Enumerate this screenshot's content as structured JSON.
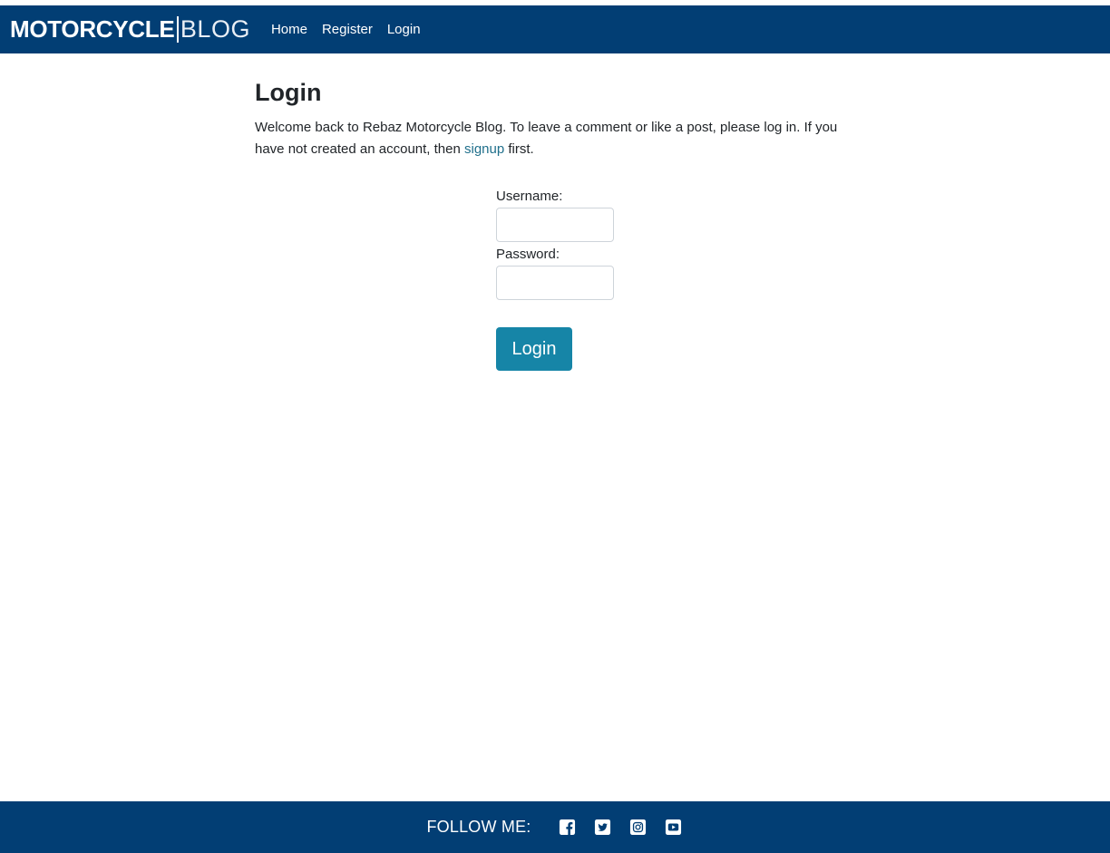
{
  "navbar": {
    "brand_bold": "MOTORCYCLE",
    "brand_light": "BLOG",
    "links": [
      {
        "label": "Home"
      },
      {
        "label": "Register"
      },
      {
        "label": "Login"
      }
    ]
  },
  "main": {
    "title": "Login",
    "intro_before_link": "Welcome back to Rebaz Motorcycle Blog. To leave a comment or like a post, please log in. If you have not created an account, then ",
    "intro_link": "signup",
    "intro_after_link": " first."
  },
  "form": {
    "username_label": "Username:",
    "username_value": "",
    "password_label": "Password:",
    "password_value": "",
    "submit_label": "Login"
  },
  "footer": {
    "follow_label": "FOLLOW ME:",
    "social_icons": [
      "facebook-icon",
      "twitter-icon",
      "instagram-icon",
      "youtube-icon"
    ]
  },
  "colors": {
    "navbar_bg": "#023e74",
    "footer_bg": "#023e74",
    "button_bg": "#1685a7",
    "link": "#1f6f8b"
  }
}
